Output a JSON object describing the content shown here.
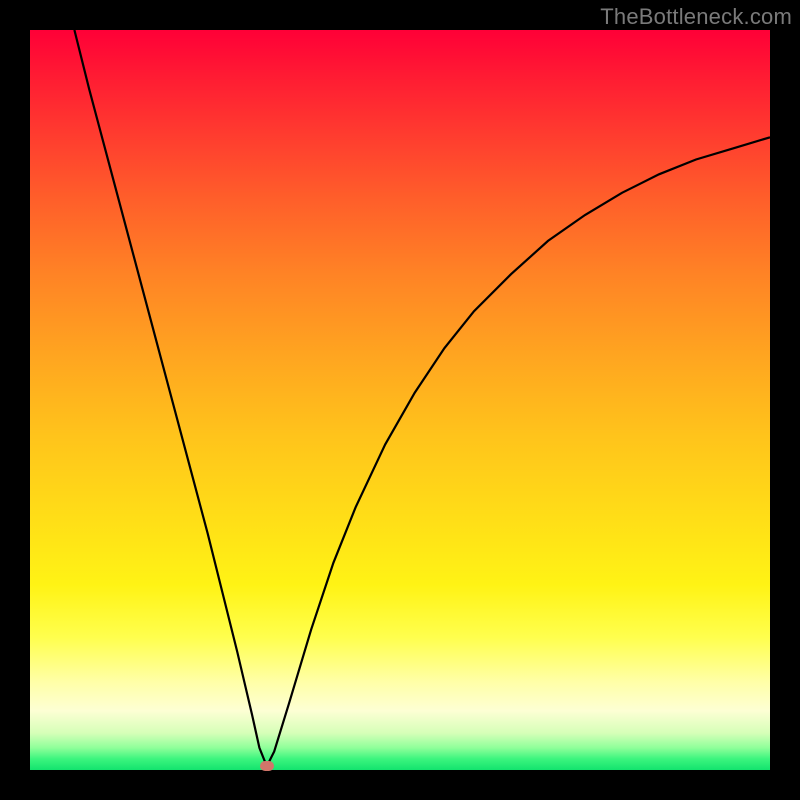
{
  "watermark": "TheBottleneck.com",
  "chart_data": {
    "type": "line",
    "title": "",
    "xlabel": "",
    "ylabel": "",
    "xlim": [
      0,
      100
    ],
    "ylim": [
      0,
      100
    ],
    "grid": false,
    "series": [
      {
        "name": "bottleneck-curve",
        "x": [
          6,
          8,
          10,
          12,
          14,
          16,
          18,
          20,
          22,
          24,
          26,
          28,
          30,
          31,
          32,
          33,
          35,
          38,
          41,
          44,
          48,
          52,
          56,
          60,
          65,
          70,
          75,
          80,
          85,
          90,
          95,
          100
        ],
        "y": [
          100,
          92,
          84.5,
          77,
          69.5,
          62,
          54.5,
          47,
          39.5,
          32,
          24,
          16,
          7.5,
          3,
          0.5,
          2.5,
          9,
          19,
          28,
          35.5,
          44,
          51,
          57,
          62,
          67,
          71.5,
          75,
          78,
          80.5,
          82.5,
          84,
          85.5
        ]
      }
    ],
    "marker": {
      "x": 32,
      "y": 0.5
    },
    "colors": {
      "curve": "#000000",
      "marker": "#d1756a",
      "frame": "#000000"
    }
  }
}
